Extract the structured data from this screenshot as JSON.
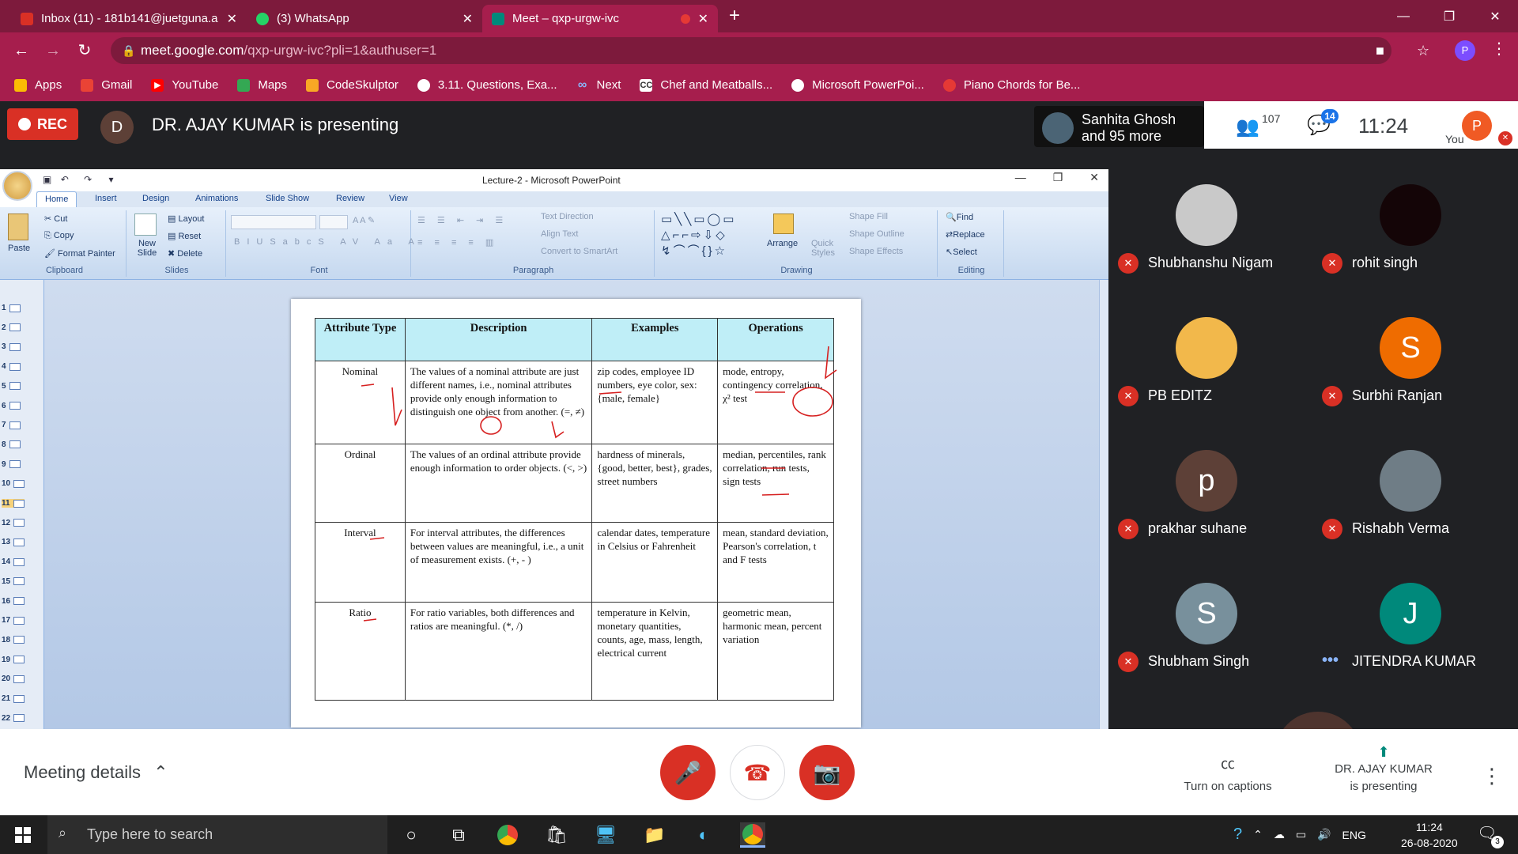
{
  "tabs": [
    {
      "title": "Inbox (11) - 181b141@juetguna.a",
      "fav_color": "#d93025"
    },
    {
      "title": "(3) WhatsApp",
      "fav_color": "#25d366"
    },
    {
      "title": "Meet – qxp-urgw-ivc",
      "fav_color": "#00897b"
    }
  ],
  "address": {
    "host": "meet.google.com",
    "path": "/qxp-urgw-ivc?pli=1&authuser=1"
  },
  "bookmarks": [
    "Apps",
    "Gmail",
    "YouTube",
    "Maps",
    "CodeSkulptor",
    "3.11. Questions, Exa...",
    "Next",
    "Chef and Meatballs...",
    "Microsoft PowerPoi...",
    "Piano Chords for Be..."
  ],
  "profile_letter": "P",
  "meet": {
    "rec_label": "REC",
    "presenter_initial": "D",
    "presenter_text": "DR. AJAY KUMAR is presenting",
    "speaker_line1": "Sanhita Ghosh",
    "speaker_line2": "and 95 more",
    "people_count": "107",
    "chat_count": "14",
    "time": "11:24",
    "you_initial": "P",
    "you_label": "You"
  },
  "ppt": {
    "title": "Lecture-2 - Microsoft PowerPoint",
    "tabs": [
      "Home",
      "Insert",
      "Design",
      "Animations",
      "Slide Show",
      "Review",
      "View"
    ],
    "clipboard": {
      "paste": "Paste",
      "cut": "Cut",
      "copy": "Copy",
      "painter": "Format Painter",
      "label": "Clipboard"
    },
    "slides": {
      "new": "New Slide",
      "layout": "Layout",
      "reset": "Reset",
      "delete": "Delete",
      "label": "Slides"
    },
    "font_label": "Font",
    "paragraph": {
      "dir": "Text Direction",
      "align": "Align Text",
      "smart": "Convert to SmartArt",
      "label": "Paragraph"
    },
    "drawing": {
      "arrange": "Arrange",
      "quick": "Quick Styles",
      "fill": "Shape Fill",
      "outline": "Shape Outline",
      "effects": "Shape Effects",
      "label": "Drawing"
    },
    "editing": {
      "find": "Find",
      "replace": "Replace",
      "select": "Select",
      "label": "Editing"
    },
    "slide_numbers": [
      "1",
      "2",
      "3",
      "4",
      "5",
      "6",
      "7",
      "8",
      "9",
      "10",
      "11",
      "12",
      "13",
      "14",
      "15",
      "16",
      "17",
      "18",
      "19",
      "20",
      "21",
      "22"
    ]
  },
  "table": {
    "headers": [
      "Attribute Type",
      "Description",
      "Examples",
      "Operations"
    ],
    "rows": [
      {
        "type": "Nominal",
        "desc": "The values of a nominal attribute are just different names, i.e., nominal attributes provide only enough information to distinguish one object from another. (=, ≠)",
        "ex": "zip codes, employee ID numbers, eye color, sex: {male, female}",
        "ops": "mode, entropy, contingency correlation, χ² test"
      },
      {
        "type": "Ordinal",
        "desc": "The values of an ordinal attribute provide enough information to order objects. (<, >)",
        "ex": "hardness of minerals, {good, better, best}, grades, street numbers",
        "ops": "median, percentiles, rank correlation, run tests, sign tests"
      },
      {
        "type": "Interval",
        "desc": "For interval attributes, the differences between values are meaningful, i.e., a unit of measurement exists. (+, - )",
        "ex": "calendar dates, temperature in Celsius or Fahrenheit",
        "ops": "mean, standard deviation, Pearson's correlation, t and F tests"
      },
      {
        "type": "Ratio",
        "desc": "For ratio variables, both differences and ratios are meaningful. (*, /)",
        "ex": "temperature in Kelvin, monetary quantities, counts, age, mass, length, electrical current",
        "ops": "geometric mean, harmonic mean, percent variation"
      }
    ]
  },
  "participants": [
    {
      "name": "Shubhanshu Nigam",
      "initial": "",
      "color": "#c9c9c9",
      "muted": true
    },
    {
      "name": "rohit singh",
      "initial": "",
      "color": "#140507",
      "muted": true
    },
    {
      "name": "PB EDITZ",
      "initial": "",
      "color": "#f2b84b",
      "muted": true
    },
    {
      "name": "Surbhi Ranjan",
      "initial": "S",
      "color": "#ef6c00",
      "muted": true
    },
    {
      "name": "prakhar suhane",
      "initial": "p",
      "color": "#5d4037",
      "muted": true
    },
    {
      "name": "Rishabh Verma",
      "initial": "",
      "color": "#6f7d86",
      "muted": true
    },
    {
      "name": "Shubham Singh",
      "initial": "S",
      "color": "#78909c",
      "muted": true
    },
    {
      "name": "JITENDRA KUMAR",
      "initial": "J",
      "color": "#00897b",
      "muted": false
    }
  ],
  "bottom": {
    "meeting_details": "Meeting details",
    "captions": "Turn on captions",
    "presenting_line1": "DR. AJAY KUMAR",
    "presenting_line2": "is presenting"
  },
  "taskbar": {
    "search_placeholder": "Type here to search",
    "lang": "ENG",
    "time": "11:24",
    "date": "26-08-2020",
    "notif_count": "3"
  }
}
